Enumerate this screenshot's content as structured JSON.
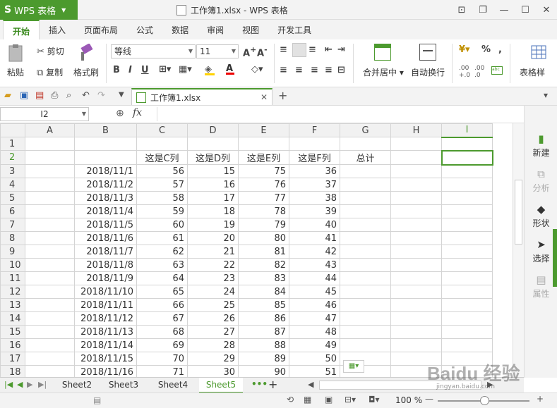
{
  "app": {
    "name": "WPS 表格",
    "window_title": "工作簿1.xlsx - WPS 表格"
  },
  "tabs": [
    "开始",
    "插入",
    "页面布局",
    "公式",
    "数据",
    "审阅",
    "视图",
    "开发工具"
  ],
  "ribbon": {
    "paste": "粘贴",
    "cut": "剪切",
    "copy": "复制",
    "format_painter": "格式刷",
    "font_name": "等线",
    "font_size": "11",
    "merge_center": "合并居中",
    "wrap_text": "自动换行",
    "table_style": "表格样"
  },
  "doc_tab": {
    "name": "工作簿1.xlsx"
  },
  "formula_bar": {
    "cell_ref": "I2",
    "fx": "fx"
  },
  "columns": [
    "A",
    "B",
    "C",
    "D",
    "E",
    "F",
    "G",
    "H",
    "I"
  ],
  "header_row": {
    "row": "2",
    "C": "这是C列",
    "D": "这是D列",
    "E": "这是E列",
    "F": "这是F列",
    "G": "总计"
  },
  "rows": [
    {
      "row": "3",
      "B": "2018/11/1",
      "C": "56",
      "D": "15",
      "E": "75",
      "F": "36"
    },
    {
      "row": "4",
      "B": "2018/11/2",
      "C": "57",
      "D": "16",
      "E": "76",
      "F": "37"
    },
    {
      "row": "5",
      "B": "2018/11/3",
      "C": "58",
      "D": "17",
      "E": "77",
      "F": "38"
    },
    {
      "row": "6",
      "B": "2018/11/4",
      "C": "59",
      "D": "18",
      "E": "78",
      "F": "39"
    },
    {
      "row": "7",
      "B": "2018/11/5",
      "C": "60",
      "D": "19",
      "E": "79",
      "F": "40"
    },
    {
      "row": "8",
      "B": "2018/11/6",
      "C": "61",
      "D": "20",
      "E": "80",
      "F": "41"
    },
    {
      "row": "9",
      "B": "2018/11/7",
      "C": "62",
      "D": "21",
      "E": "81",
      "F": "42"
    },
    {
      "row": "10",
      "B": "2018/11/8",
      "C": "63",
      "D": "22",
      "E": "82",
      "F": "43"
    },
    {
      "row": "11",
      "B": "2018/11/9",
      "C": "64",
      "D": "23",
      "E": "83",
      "F": "44"
    },
    {
      "row": "12",
      "B": "2018/11/10",
      "C": "65",
      "D": "24",
      "E": "84",
      "F": "45"
    },
    {
      "row": "13",
      "B": "2018/11/11",
      "C": "66",
      "D": "25",
      "E": "85",
      "F": "46"
    },
    {
      "row": "14",
      "B": "2018/11/12",
      "C": "67",
      "D": "26",
      "E": "86",
      "F": "47"
    },
    {
      "row": "15",
      "B": "2018/11/13",
      "C": "68",
      "D": "27",
      "E": "87",
      "F": "48"
    },
    {
      "row": "16",
      "B": "2018/11/14",
      "C": "69",
      "D": "28",
      "E": "88",
      "F": "49"
    },
    {
      "row": "17",
      "B": "2018/11/15",
      "C": "70",
      "D": "29",
      "E": "89",
      "F": "50"
    },
    {
      "row": "18",
      "B": "2018/11/16",
      "C": "71",
      "D": "30",
      "E": "90",
      "F": "51"
    }
  ],
  "right_panel": [
    "新建",
    "分析",
    "形状",
    "选择",
    "属性"
  ],
  "sheets": [
    "Sheet2",
    "Sheet3",
    "Sheet4",
    "Sheet5"
  ],
  "active_sheet": "Sheet5",
  "status": {
    "zoom": "100 %"
  },
  "watermark": {
    "text": "Baidu 经验",
    "url": "jingyan.baidu.com"
  },
  "colors": {
    "accent": "#4c9a2e"
  }
}
